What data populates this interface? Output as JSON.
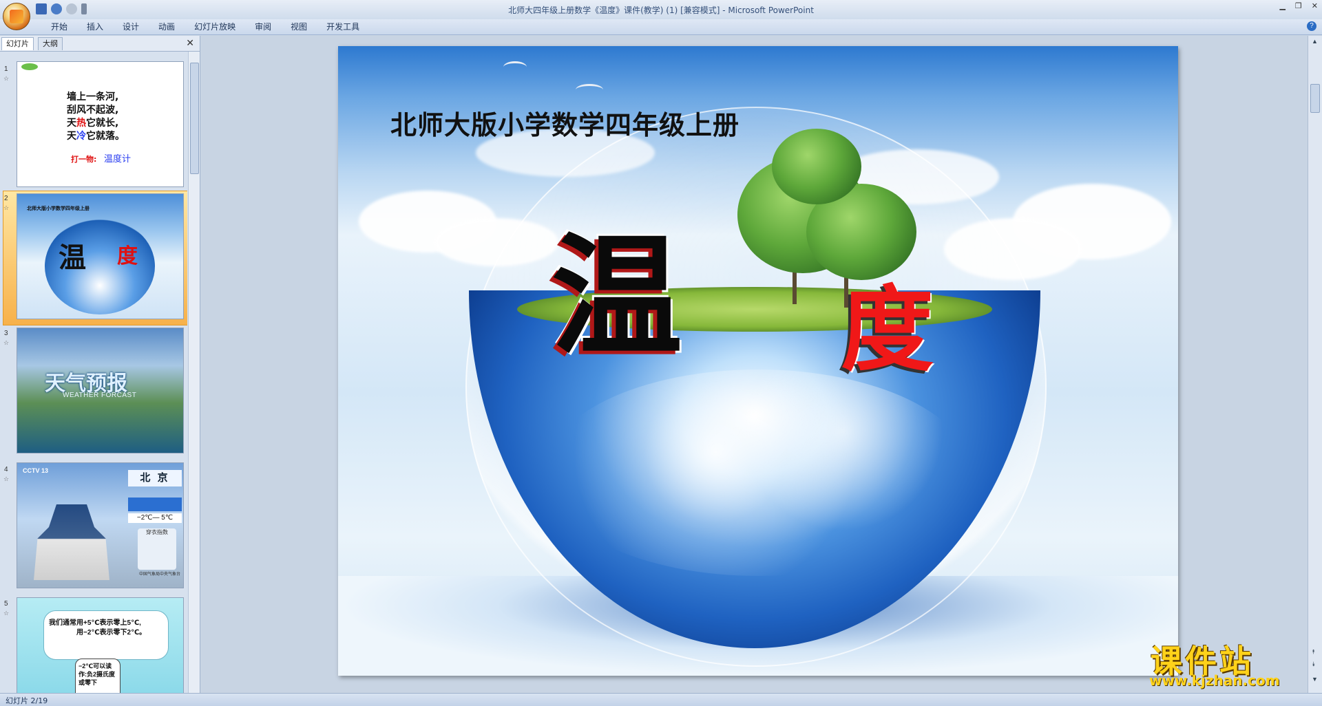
{
  "window": {
    "title": "北师大四年级上册数学《温度》课件(教学) (1) [兼容模式] - Microsoft PowerPoint"
  },
  "ribbon": {
    "tabs": [
      "开始",
      "插入",
      "设计",
      "动画",
      "幻灯片放映",
      "审阅",
      "视图",
      "开发工具"
    ]
  },
  "panel": {
    "tab_slides": "幻灯片",
    "tab_outline": "大纲"
  },
  "thumbnails": [
    {
      "num": "1",
      "poem": [
        "墙上一条河,",
        "刮风不起波,",
        "天",
        "热",
        "它就长,",
        "天",
        "冷",
        "它就落。"
      ],
      "riddle_label": "打一物:",
      "riddle_answer": "温度计"
    },
    {
      "num": "2",
      "title": "北师大版小学数学四年级上册",
      "w": "温",
      "d": "度"
    },
    {
      "num": "3",
      "title_cn": "天气预报",
      "title_en": "WEATHER FORCAST"
    },
    {
      "num": "4",
      "logo": "CCTV 13",
      "city": "北 京",
      "temp": "−2℃— 5℃",
      "dress": "穿衣指数",
      "source": "中国气象局中央气象台"
    },
    {
      "num": "5",
      "text1": "我们通常用+5℃表示零上5℃,",
      "text2": "用−2℃表示零下2℃。",
      "bubble": "−2℃可以读作:负2摄氏度或零下"
    }
  ],
  "slide": {
    "title": "北师大版小学数学四年级上册",
    "char1": "温",
    "char2": "度"
  },
  "watermark": {
    "name": "课件站",
    "url": "www.kjzhan.com"
  },
  "status": {
    "text": "幻灯片 2/19"
  },
  "colors": {
    "accent_red": "#f01818",
    "selection": "#f7b14a",
    "watermark": "#ffd21a"
  }
}
